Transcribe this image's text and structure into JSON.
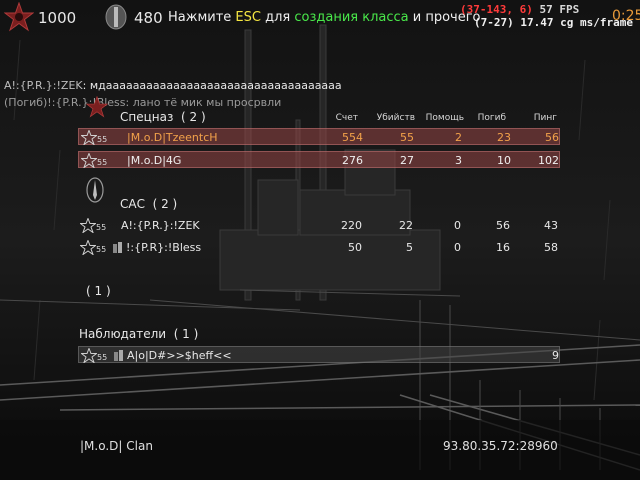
{
  "hud": {
    "score": "1000",
    "xp": "480",
    "hint_prefix": "Нажмите ",
    "hint_key": "ESC",
    "hint_mid": " для ",
    "hint_action": "создания класса",
    "hint_suffix": " и прочего",
    "fps_coords": "(37-143, 6)",
    "fps_value": "57 FPS",
    "net_coords": "(7-27)",
    "net_value": "17.47 cg ms/frame",
    "timer": "0:25",
    "colors": {
      "fps_coords": "#ff3a3a",
      "fps_value": "#f0f0f0",
      "hint_key": "#f5e642",
      "hint_action": "#49e84a",
      "timer": "#e89a3a"
    }
  },
  "chat": [
    {
      "name": "A!:{P.R.}:!ZEK",
      "text": "мдааааааааааааааааааааааааааааааааааа"
    },
    {
      "prefix": "(Погиб)",
      "name": "!:{P.R.}:!Bless",
      "text": "лано тё мик мы просрвли"
    }
  ],
  "scoreboard": {
    "columns": {
      "score": "Счет",
      "kills": "Убийств",
      "assists": "Помощь",
      "deaths": "Погиб",
      "ping": "Пинг"
    },
    "teams": [
      {
        "name": "Спецназ",
        "count": "( 2 )",
        "icon": "spetsnaz-star-icon",
        "players": [
          {
            "rank": "55",
            "name": "|M.o.D|TzeentcH",
            "score": "554",
            "kills": "55",
            "assists": "2",
            "deaths": "23",
            "ping": "56",
            "highlight": "self"
          },
          {
            "rank": "55",
            "name": "|M.o.D|4G",
            "score": "276",
            "kills": "27",
            "assists": "3",
            "deaths": "10",
            "ping": "102",
            "highlight": "clan"
          }
        ]
      },
      {
        "name": "САС",
        "count": "( 2 )",
        "icon": "sas-dagger-icon",
        "players": [
          {
            "rank": "55",
            "name": "A!:{P.R.}:!ZEK",
            "score": "220",
            "kills": "22",
            "assists": "0",
            "deaths": "56",
            "ping": "43"
          },
          {
            "rank": "55",
            "name": "!:{P.R}:!Bless",
            "score": "50",
            "kills": "5",
            "assists": "0",
            "deaths": "16",
            "ping": "58",
            "status_icon": "dead-icon"
          }
        ]
      }
    ],
    "unassigned_count": "( 1 )",
    "spectators": {
      "title": "Наблюдатели",
      "count": "( 1 )",
      "players": [
        {
          "rank": "55",
          "name": "A|o|D#>>$heff<<",
          "ping": "9",
          "status_icon": "dead-icon"
        }
      ]
    }
  },
  "footer": {
    "clan": "|M.o.D| Clan",
    "server": "93.80.35.72:28960"
  }
}
